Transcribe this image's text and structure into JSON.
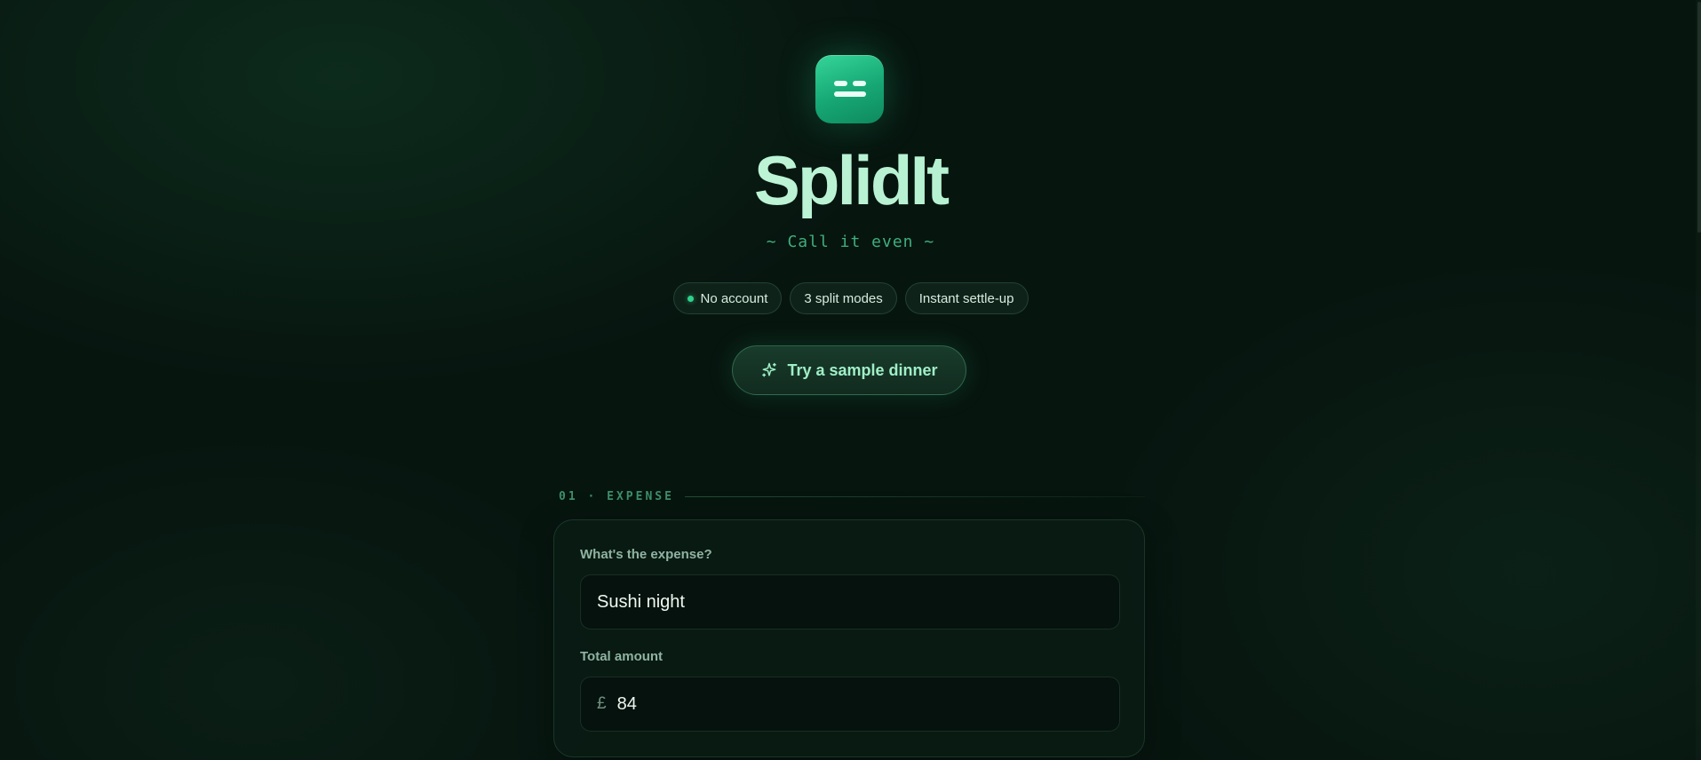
{
  "app": {
    "title": "SplidIt",
    "tagline": "~ Call it even ~"
  },
  "chips": [
    {
      "label": "No account",
      "has_dot": true
    },
    {
      "label": "3 split modes",
      "has_dot": false
    },
    {
      "label": "Instant settle-up",
      "has_dot": false
    }
  ],
  "cta": {
    "label": "Try a sample dinner",
    "icon": "sparkle-icon"
  },
  "expense_section": {
    "label": "01 · EXPENSE",
    "name_field": {
      "label": "What's the expense?",
      "value": "Sushi night"
    },
    "amount_field": {
      "label": "Total amount",
      "currency": "£",
      "value": "84"
    }
  },
  "colors": {
    "background": "#07150f",
    "accent": "#2fd18d",
    "logo_gradient_start": "#35d59a",
    "logo_gradient_end": "#0f8a5e",
    "title": "#bff5d7",
    "tagline": "#3fae7e"
  }
}
